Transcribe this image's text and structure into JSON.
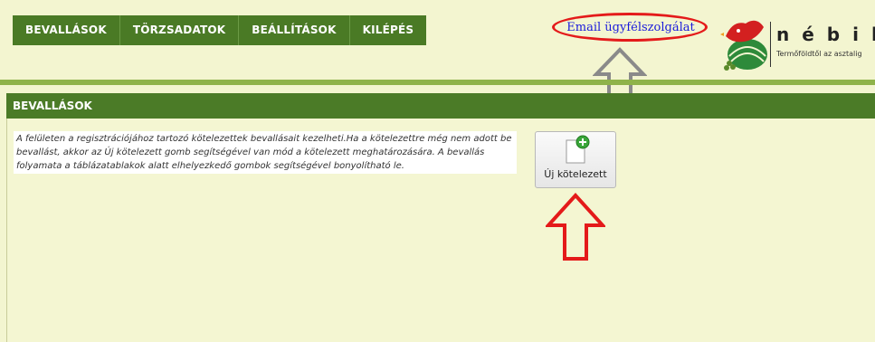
{
  "nav": {
    "items": [
      {
        "label": "BEVALLÁSOK"
      },
      {
        "label": "TÖRZSADATOK"
      },
      {
        "label": "BEÁLLÍTÁSOK"
      },
      {
        "label": "KILÉPÉS"
      }
    ]
  },
  "header": {
    "email_link": "Email ügyfélszolgálat"
  },
  "logo": {
    "letters": "nébih",
    "tagline": "Termőföldtől az asztalig"
  },
  "section": {
    "title": "BEVALLÁSOK",
    "description": "A felületen a regisztrációjához tartozó kötelezettek bevallásait kezelheti.Ha a kötelezettre még nem adott be bevallást, akkor az Új kötelezett gomb segítségével van mód a kötelezett meghatározására. A bevallás folyamata a táblázatablakok alatt elhelyezkedő gombok segítségével bonyolítható le."
  },
  "buttons": {
    "new_obligor": "Új kötelezett"
  },
  "colors": {
    "nav_bg": "#4a7a25",
    "page_bg": "#f3f5d0",
    "highlight_red": "#e41a1a",
    "arrow_gray": "#8a8a8a",
    "link_blue": "#1a1adb"
  }
}
